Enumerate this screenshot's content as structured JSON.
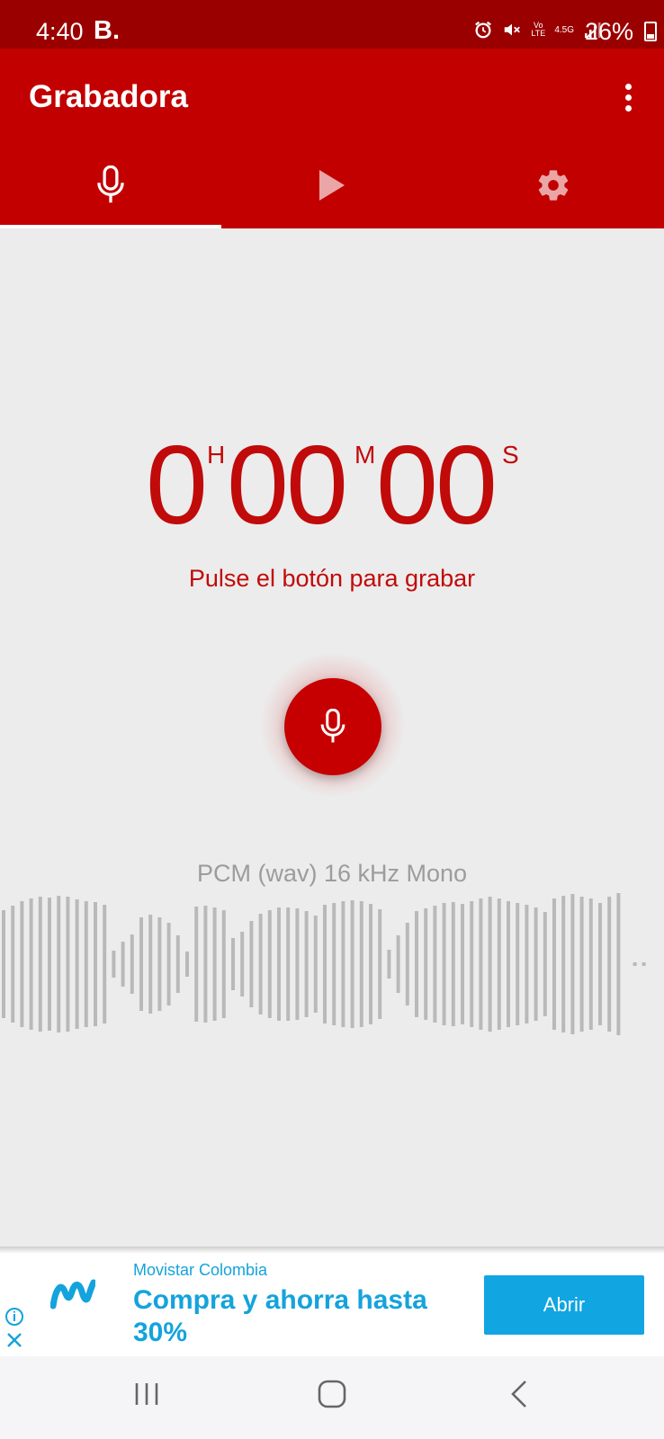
{
  "status_bar": {
    "time": "4:40",
    "carrier_badge": "B.",
    "battery": "26%",
    "network_label": "4.5G",
    "volte_label": "Vo LTE"
  },
  "app_bar": {
    "title": "Grabadora"
  },
  "tabs": [
    {
      "icon": "microphone-icon",
      "selected": true
    },
    {
      "icon": "play-icon",
      "selected": false
    },
    {
      "icon": "gear-icon",
      "selected": false
    }
  ],
  "timer": {
    "hours": "0",
    "hours_unit": "H",
    "minutes": "00",
    "minutes_unit": "M",
    "seconds": "00",
    "seconds_unit": "S"
  },
  "hint": "Pulse el botón para grabar",
  "record_button": {
    "icon": "microphone-icon"
  },
  "format": "PCM (wav) 16 kHz Mono",
  "ad": {
    "advertiser": "Movistar Colombia",
    "headline": "Compra y ahorra hasta 30%",
    "cta": "Abrir",
    "brand_color": "#14a3dc"
  },
  "colors": {
    "primary": "#c20000",
    "status_bar": "#9b0000",
    "accent_text": "#c10a0a",
    "background": "#ececec"
  }
}
